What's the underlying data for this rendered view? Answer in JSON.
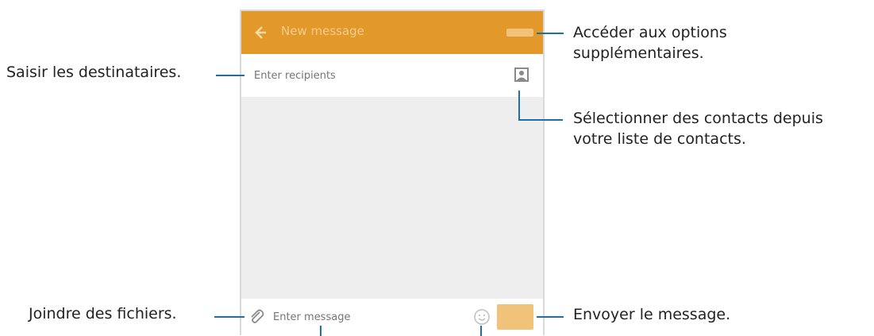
{
  "screen": {
    "title": "New message",
    "recipient_placeholder": "Enter recipients",
    "message_placeholder": "Enter message"
  },
  "callouts": {
    "options": [
      "Accéder aux options",
      "supplémentaires."
    ],
    "recipients": "Saisir les destinataires.",
    "contacts": [
      "Sélectionner des contacts depuis",
      "votre liste de contacts."
    ],
    "attach": "Joindre des fichiers.",
    "send": "Envoyer le message."
  },
  "colors": {
    "appbar": "#e3982a",
    "callout_line": "#1f6ea8"
  },
  "icons": [
    "back-arrow-icon",
    "more-options-icon",
    "contacts-icon",
    "attach-icon",
    "emoji-icon",
    "send-icon"
  ]
}
